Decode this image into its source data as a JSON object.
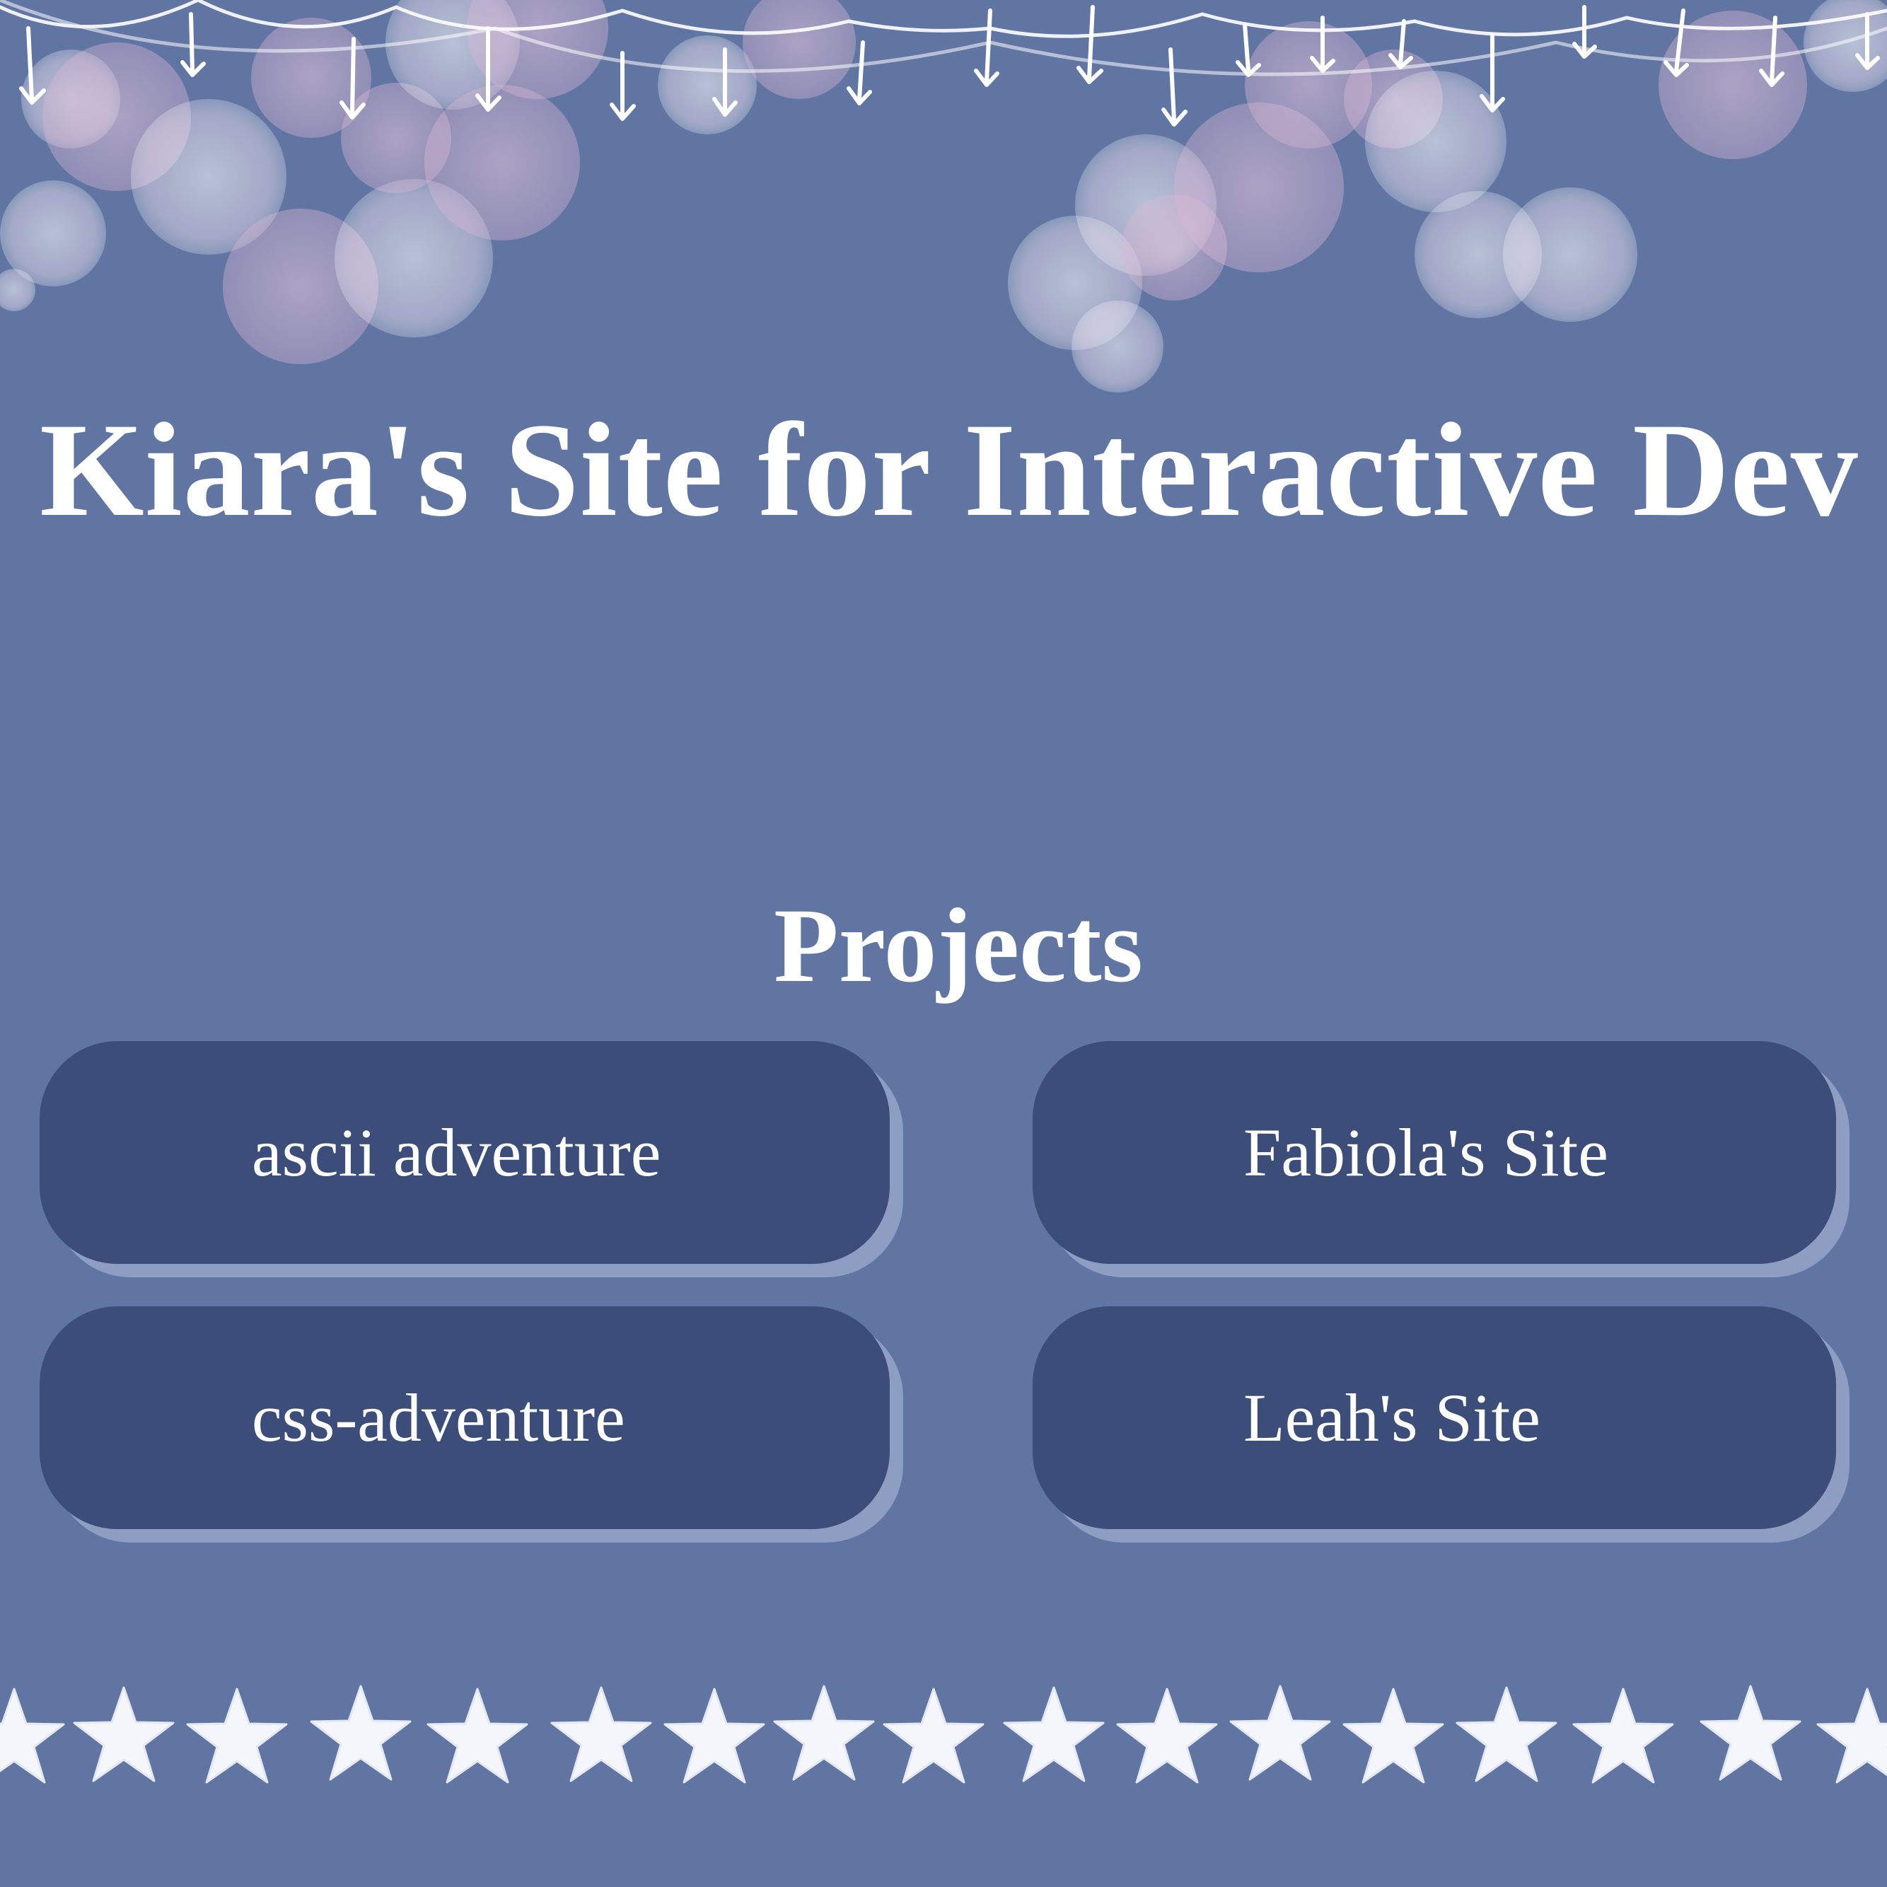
{
  "header": {
    "title": "Kiara's Site for Interactive Dev"
  },
  "projects": {
    "heading": "Projects",
    "items": [
      {
        "label": "ascii adventure"
      },
      {
        "label": "Fabiola's Site"
      },
      {
        "label": "css-adventure"
      },
      {
        "label": "Leah's Site"
      }
    ]
  },
  "decor": {
    "banner": "string-lights-bokeh",
    "footer": "star-border",
    "colors": {
      "background": "#6175a3",
      "button": "#3c4d7a",
      "button_shadow": "#8e9ec3",
      "text": "#ffffff"
    }
  }
}
